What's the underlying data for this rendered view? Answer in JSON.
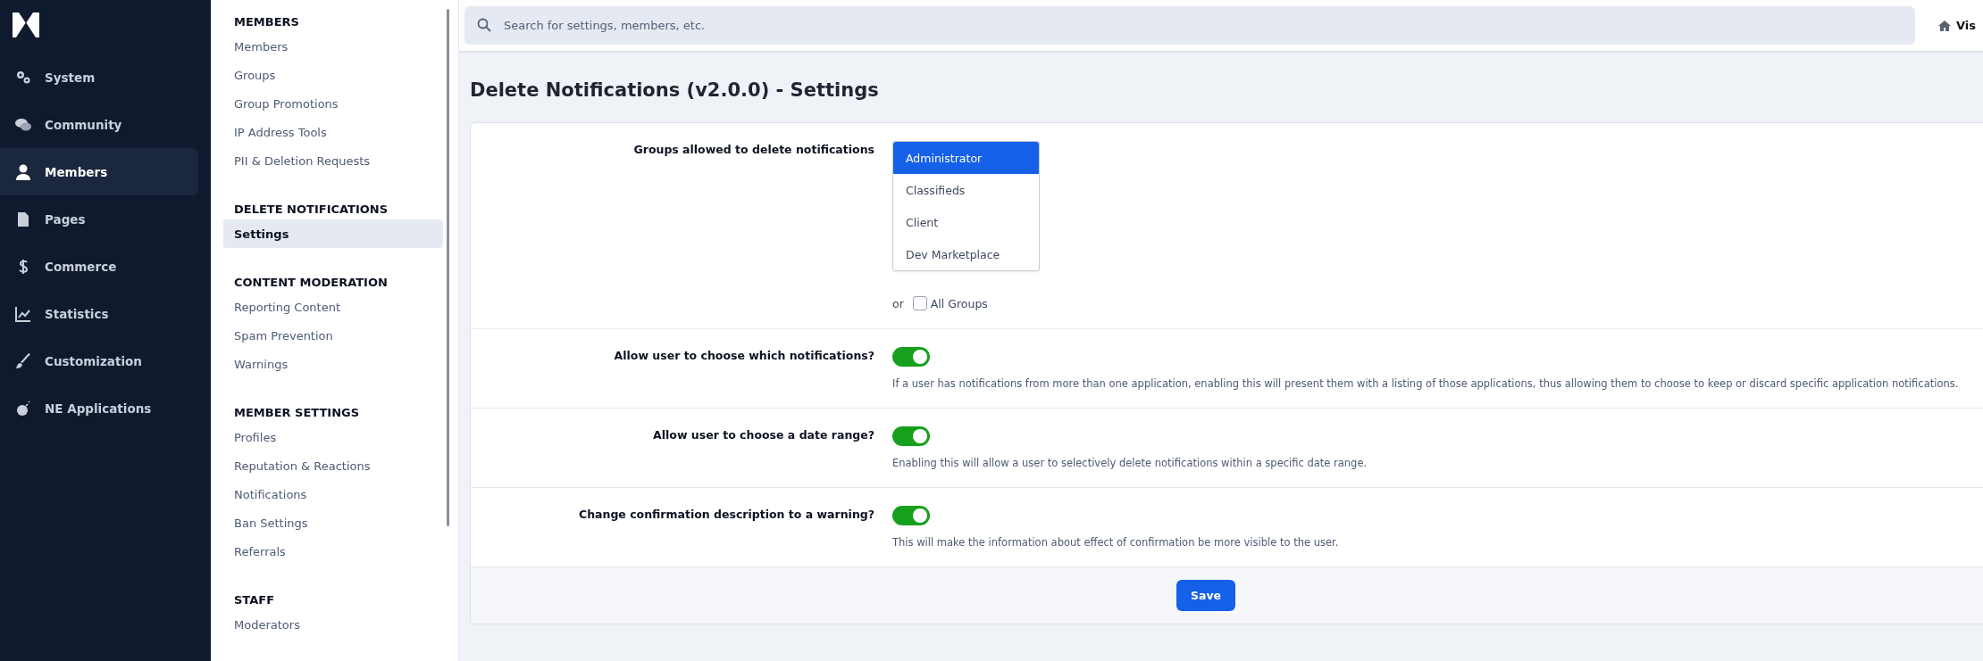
{
  "nav": {
    "items": [
      {
        "label": "System",
        "selected": false
      },
      {
        "label": "Community",
        "selected": false
      },
      {
        "label": "Members",
        "selected": true
      },
      {
        "label": "Pages",
        "selected": false
      },
      {
        "label": "Commerce",
        "selected": false
      },
      {
        "label": "Statistics",
        "selected": false
      },
      {
        "label": "Customization",
        "selected": false
      },
      {
        "label": "NE Applications",
        "selected": false
      }
    ]
  },
  "subnav": {
    "sections": [
      {
        "title": "MEMBERS",
        "items": [
          {
            "label": "Members",
            "selected": false
          },
          {
            "label": "Groups",
            "selected": false
          },
          {
            "label": "Group Promotions",
            "selected": false
          },
          {
            "label": "IP Address Tools",
            "selected": false
          },
          {
            "label": "PII & Deletion Requests",
            "selected": false
          }
        ]
      },
      {
        "title": "DELETE NOTIFICATIONS",
        "items": [
          {
            "label": "Settings",
            "selected": true
          }
        ]
      },
      {
        "title": "CONTENT MODERATION",
        "items": [
          {
            "label": "Reporting Content",
            "selected": false
          },
          {
            "label": "Spam Prevention",
            "selected": false
          },
          {
            "label": "Warnings",
            "selected": false
          }
        ]
      },
      {
        "title": "MEMBER SETTINGS",
        "items": [
          {
            "label": "Profiles",
            "selected": false
          },
          {
            "label": "Reputation & Reactions",
            "selected": false
          },
          {
            "label": "Notifications",
            "selected": false
          },
          {
            "label": "Ban Settings",
            "selected": false
          },
          {
            "label": "Referrals",
            "selected": false
          }
        ]
      },
      {
        "title": "STAFF",
        "items": [
          {
            "label": "Moderators",
            "selected": false
          }
        ]
      }
    ]
  },
  "header": {
    "search": {
      "placeholder": "Search for settings, members, etc."
    },
    "visit_link": "Vis"
  },
  "page_title": "Delete Notifications (v2.0.0) - Settings",
  "settings": [
    {
      "kind": "listbox",
      "label": "Groups allowed to delete notifications",
      "options": [
        {
          "label": "Administrator",
          "selected": true
        },
        {
          "label": "Classifieds",
          "selected": false
        },
        {
          "label": "Client",
          "selected": false
        },
        {
          "label": "Dev Marketplace",
          "selected": false
        }
      ],
      "or_text": "or",
      "all_groups": {
        "label": "All Groups",
        "checked": false
      }
    },
    {
      "kind": "toggle",
      "label": "Allow user to choose which notifications?",
      "on": true,
      "description": "If a user has notifications from more than one application, enabling this will present them with a listing of those applications, thus allowing them to choose to keep or discard specific application notifications."
    },
    {
      "kind": "toggle",
      "label": "Allow user to choose a date range?",
      "on": true,
      "description": "Enabling this will allow a user to selectively delete notifications within a specific date range."
    },
    {
      "kind": "toggle",
      "label": "Change confirmation description to a warning?",
      "on": true,
      "description": "This will make the information about effect of confirmation be more visible to the user."
    }
  ],
  "save_button": "Save"
}
